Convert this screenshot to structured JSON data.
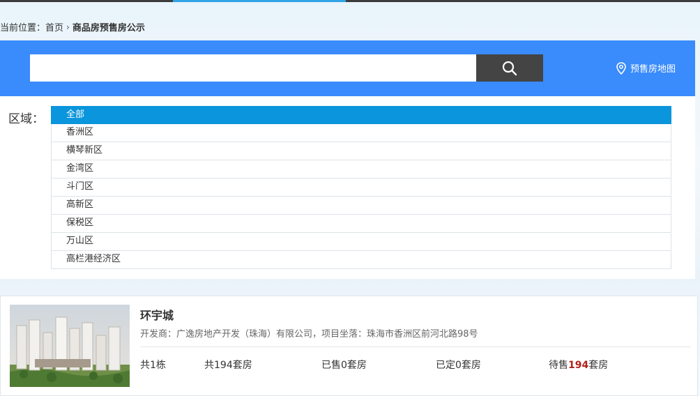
{
  "breadcrumb": {
    "prefix": "当前位置：",
    "home": "首页",
    "separator": "›",
    "current": "商品房预售房公示"
  },
  "search": {
    "value": "",
    "placeholder": "",
    "button_icon": "search-icon"
  },
  "map_link": {
    "icon": "location-pin-icon",
    "label": "预售房地图"
  },
  "filter": {
    "label": "区域：",
    "selected": "全部",
    "items": [
      "全部",
      "香洲区",
      "横琴新区",
      "金湾区",
      "斗门区",
      "高新区",
      "保税区",
      "万山区",
      "高栏港经济区"
    ]
  },
  "listing": {
    "title": "环宇城",
    "description": "开发商：广逸房地产开发（珠海）有限公司，项目坐落：珠海市香洲区前河北路98号",
    "buildings": "共1栋",
    "total_units": "共194套房",
    "sold": "已售0套房",
    "reserved": "已定0套房",
    "for_sale_prefix": "待售",
    "for_sale_count": "194",
    "for_sale_suffix": "套房"
  },
  "colors": {
    "accent_blue": "#3a8bfb",
    "active_item": "#0a95dc",
    "highlight_red": "#b3201c"
  }
}
